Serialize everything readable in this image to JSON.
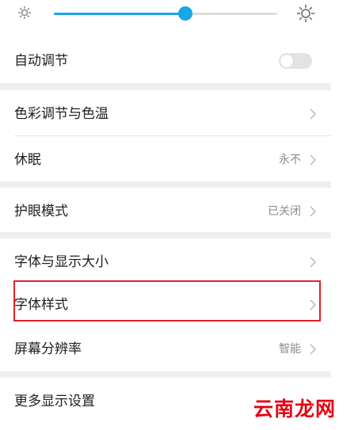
{
  "brightness": {
    "level": 0.59
  },
  "auto_adjust": {
    "label": "自动调节",
    "enabled": false
  },
  "settings": [
    {
      "label": "色彩调节与色温",
      "value": ""
    },
    {
      "label": "休眠",
      "value": "永不"
    },
    {
      "label": "护眼模式",
      "value": "已关闭"
    },
    {
      "label": "字体与显示大小",
      "value": ""
    },
    {
      "label": "字体样式",
      "value": "",
      "highlighted": true
    },
    {
      "label": "屏幕分辨率",
      "value": "智能"
    },
    {
      "label": "更多显示设置",
      "value": ""
    }
  ],
  "watermark": "云南龙网",
  "colors": {
    "accent": "#1aa6e6",
    "highlight": "#e02222",
    "watermark": "#e60012"
  },
  "icons": [
    "sun-dim-icon",
    "sun-bright-icon",
    "chevron-right-icon"
  ]
}
